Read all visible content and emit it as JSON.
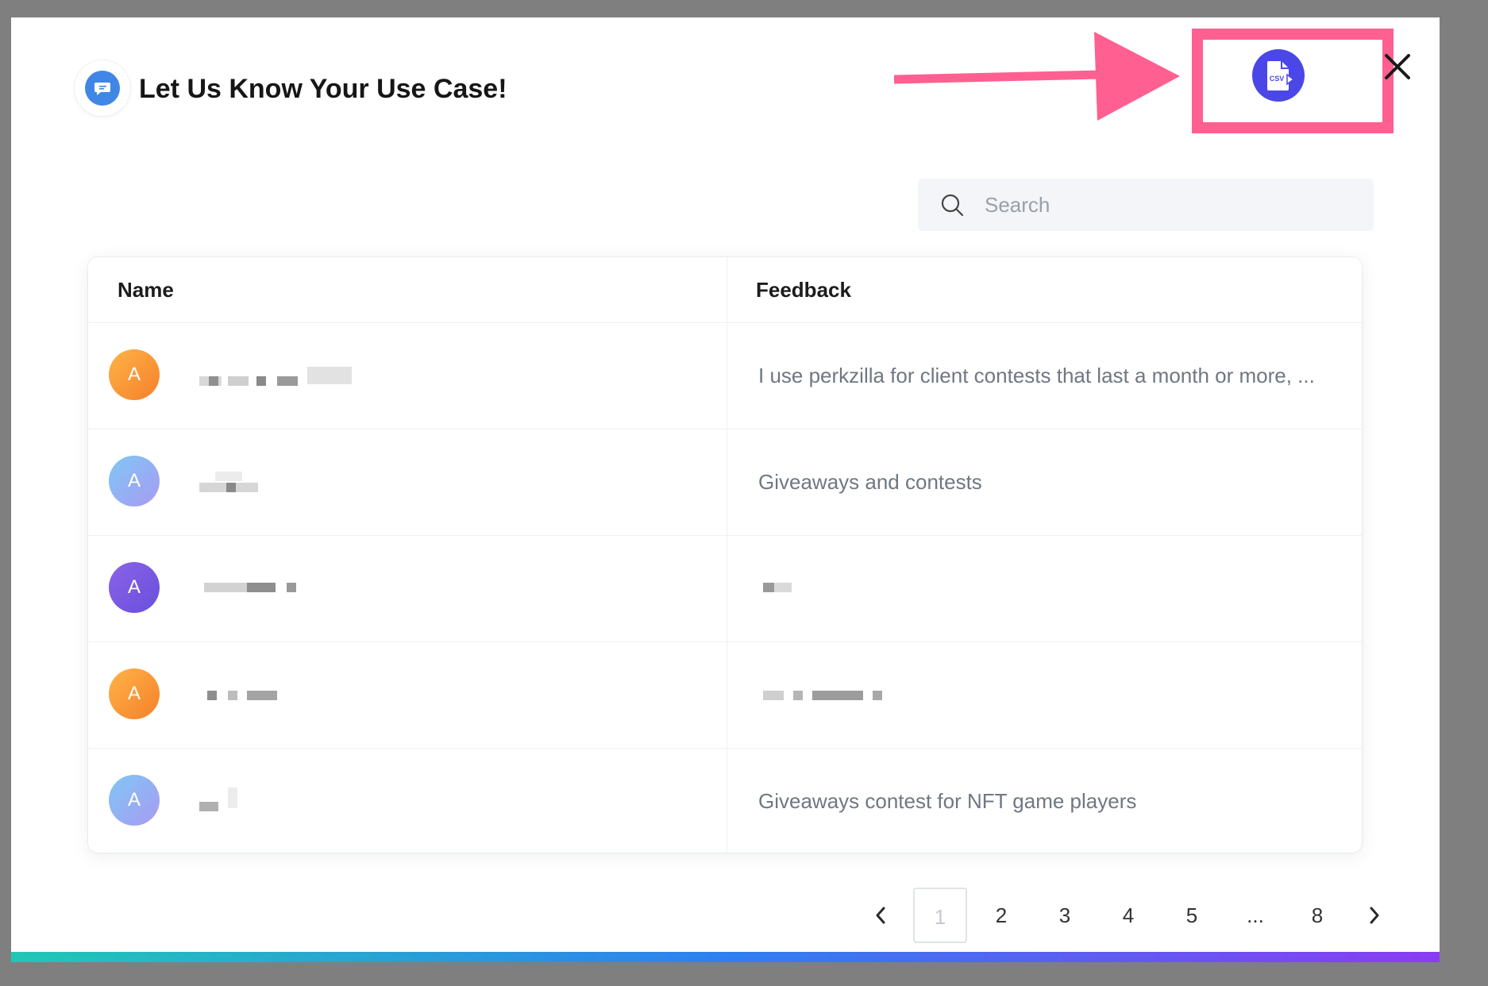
{
  "modal": {
    "title": "Let Us Know Your Use Case!",
    "csv_export_label": "CSV",
    "close_label": "✕"
  },
  "search": {
    "placeholder": "Search"
  },
  "table": {
    "columns": [
      "Name",
      "Feedback"
    ],
    "rows": [
      {
        "avatar_letter": "A",
        "avatar_style": "orange",
        "name": "",
        "feedback": "I use perkzilla for client contests that last a month or more, ..."
      },
      {
        "avatar_letter": "A",
        "avatar_style": "blue",
        "name": "",
        "feedback": "Giveaways and contests"
      },
      {
        "avatar_letter": "A",
        "avatar_style": "purple",
        "name": "",
        "feedback": ""
      },
      {
        "avatar_letter": "A",
        "avatar_style": "orange",
        "name": "",
        "feedback": ""
      },
      {
        "avatar_letter": "A",
        "avatar_style": "blue",
        "name": "",
        "feedback": "Giveaways contest for NFT game players"
      }
    ]
  },
  "pagination": {
    "current": "1",
    "pages": [
      "1",
      "2",
      "3",
      "4",
      "5",
      "...",
      "8"
    ],
    "prev_label": "‹",
    "next_label": "›"
  },
  "colors": {
    "accent": "#4a47e6",
    "annotation": "#ff5f91",
    "header_icon": "#3f86e6"
  }
}
